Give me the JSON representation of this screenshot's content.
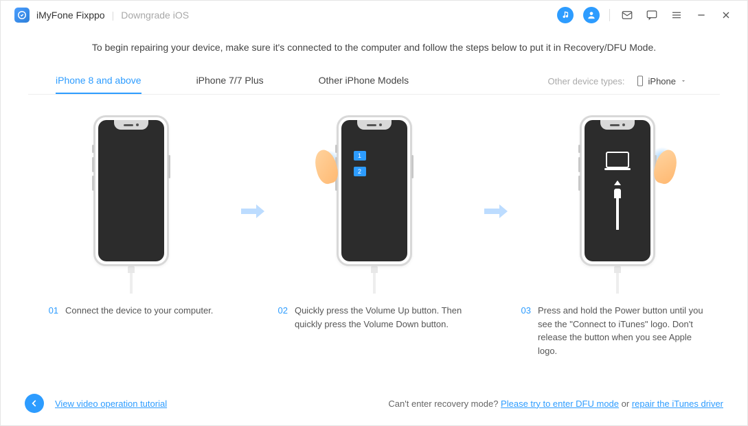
{
  "header": {
    "app_name": "iMyFone Fixppo",
    "subtitle": "Downgrade iOS"
  },
  "instruction": "To begin repairing your device, make sure it's connected to the computer and follow the steps below to put it in Recovery/DFU Mode.",
  "tabs": {
    "items": [
      {
        "label": "iPhone 8 and above",
        "active": true
      },
      {
        "label": "iPhone 7/7 Plus",
        "active": false
      },
      {
        "label": "Other iPhone Models",
        "active": false
      }
    ],
    "other_label": "Other device types:",
    "selected_device": "iPhone"
  },
  "steps": [
    {
      "num": "01",
      "desc": "Connect the device to your computer."
    },
    {
      "num": "02",
      "desc": "Quickly press the Volume Up button. Then quickly press the Volume Down button."
    },
    {
      "num": "03",
      "desc": "Press and hold the Power button until you see the \"Connect to iTunes\" logo. Don't release the button when you see Apple logo."
    }
  ],
  "badges": {
    "b1": "1",
    "b2": "2"
  },
  "footer": {
    "tutorial_link": "View video operation tutorial",
    "help_prefix": "Can't enter recovery mode? ",
    "dfu_link": "Please try to enter DFU mode",
    "or": " or ",
    "driver_link": "repair the iTunes driver"
  }
}
